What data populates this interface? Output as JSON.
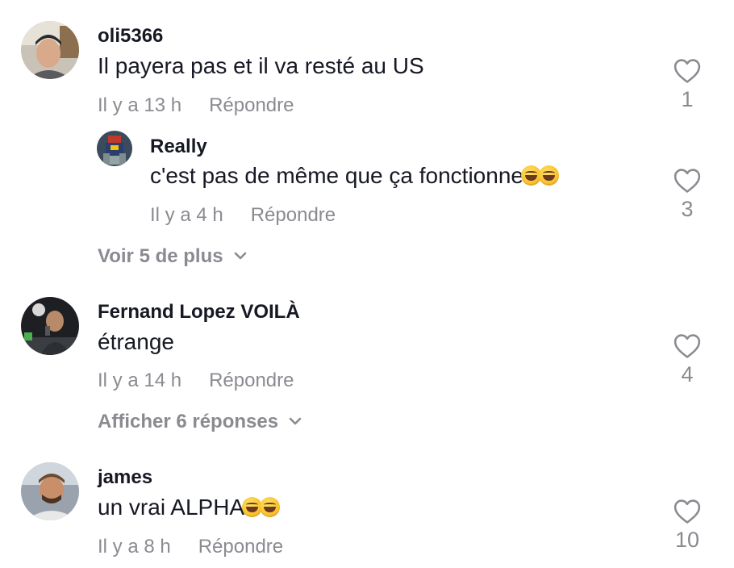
{
  "comments": [
    {
      "username": "oli5366",
      "text": "Il payera pas et il va resté au US",
      "time": "Il y a 13 h",
      "reply_label": "Répondre",
      "likes": "1",
      "more_label": "Voir 5 de plus",
      "replies": [
        {
          "username": "Really",
          "text": "c'est pas de même que ça fonctionne",
          "emoji": [
            "rofl-emoji",
            "rofl-emoji"
          ],
          "time": "Il y a 4 h",
          "reply_label": "Répondre",
          "likes": "3"
        }
      ]
    },
    {
      "username": "Fernand Lopez VOILÀ",
      "text": "étrange",
      "time": "Il y a 14 h",
      "reply_label": "Répondre",
      "likes": "4",
      "more_label": "Afficher 6 réponses"
    },
    {
      "username": "james",
      "text": "un vrai ALPHA",
      "emoji": [
        "joy-emoji",
        "joy-emoji"
      ],
      "time": "Il y a 8 h",
      "reply_label": "Répondre",
      "likes": "10"
    }
  ],
  "colors": {
    "primary_text": "#161823",
    "secondary_text": "#8a8b91",
    "background": "#ffffff"
  },
  "icons": {
    "like": "heart-outline-icon",
    "expand": "chevron-down-icon"
  }
}
